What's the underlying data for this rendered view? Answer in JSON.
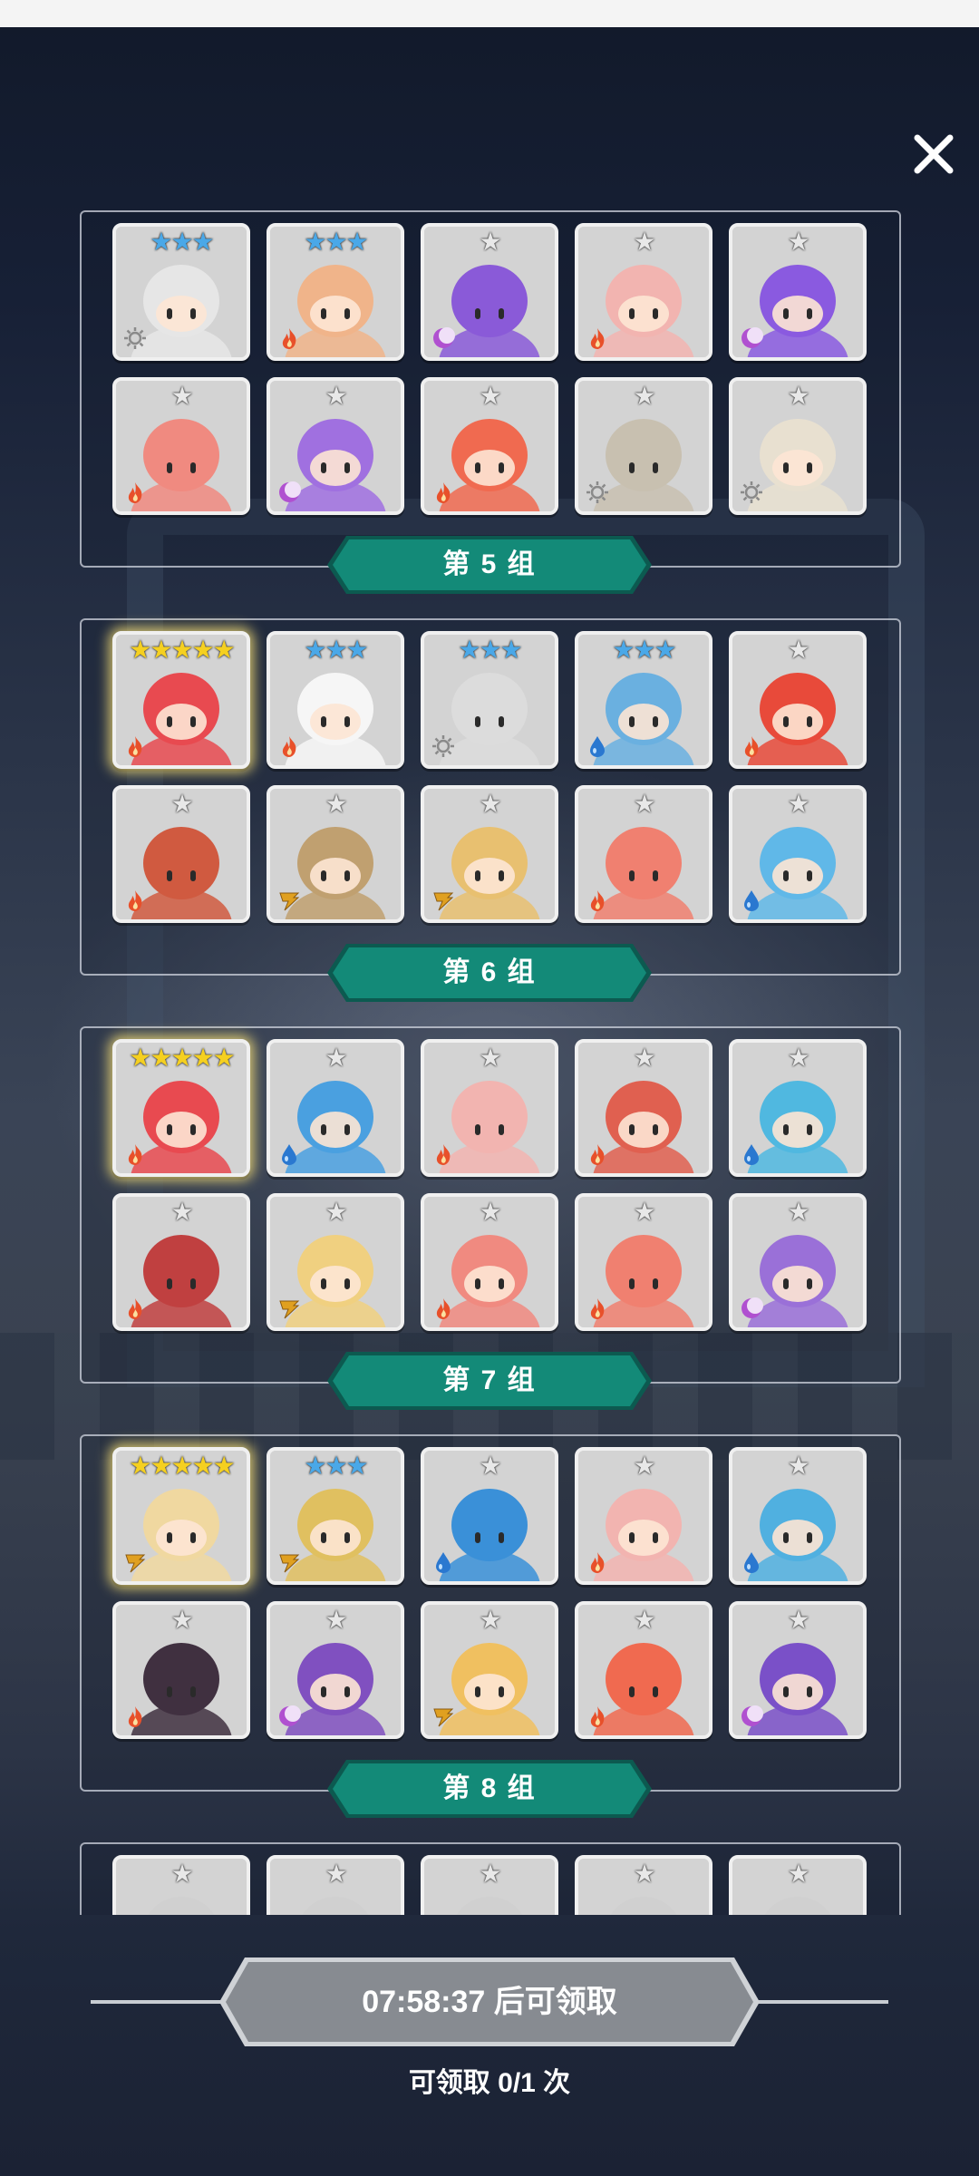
{
  "close_icon": "close-icon",
  "groups": [
    {
      "label": "第 5 组",
      "heroes": [
        {
          "stars": 3,
          "element": "light",
          "color": "#e6e6e6"
        },
        {
          "stars": 3,
          "element": "fire",
          "color": "#f0b48a"
        },
        {
          "stars": 1,
          "element": "dark",
          "color": "#8a5ad8"
        },
        {
          "stars": 1,
          "element": "fire",
          "color": "#f2b4b0"
        },
        {
          "stars": 1,
          "element": "dark",
          "color": "#8a5ae0"
        },
        {
          "stars": 1,
          "element": "fire",
          "color": "#f08a80"
        },
        {
          "stars": 1,
          "element": "dark",
          "color": "#a070e0"
        },
        {
          "stars": 1,
          "element": "fire",
          "color": "#f06a50"
        },
        {
          "stars": 1,
          "element": "light",
          "color": "#c8c0b0"
        },
        {
          "stars": 1,
          "element": "light",
          "color": "#e8e0d0"
        }
      ]
    },
    {
      "label": "第 6 组",
      "heroes": [
        {
          "stars": 5,
          "element": "fire",
          "color": "#e84a50",
          "gold": true
        },
        {
          "stars": 3,
          "element": "fire",
          "color": "#f6f6f6"
        },
        {
          "stars": 3,
          "element": "light",
          "color": "#dcdcdc"
        },
        {
          "stars": 3,
          "element": "water",
          "color": "#6ab0e0"
        },
        {
          "stars": 1,
          "element": "fire",
          "color": "#e84a3a"
        },
        {
          "stars": 1,
          "element": "fire",
          "color": "#d05a40"
        },
        {
          "stars": 1,
          "element": "thunder",
          "color": "#c0a070"
        },
        {
          "stars": 1,
          "element": "thunder",
          "color": "#e8c070"
        },
        {
          "stars": 1,
          "element": "fire",
          "color": "#f08070"
        },
        {
          "stars": 1,
          "element": "water",
          "color": "#60b8e8"
        }
      ]
    },
    {
      "label": "第 7 组",
      "heroes": [
        {
          "stars": 5,
          "element": "fire",
          "color": "#e84a50",
          "gold": true
        },
        {
          "stars": 1,
          "element": "water",
          "color": "#4aa0e0"
        },
        {
          "stars": 1,
          "element": "fire",
          "color": "#f2b4b0"
        },
        {
          "stars": 1,
          "element": "fire",
          "color": "#e06050"
        },
        {
          "stars": 1,
          "element": "water",
          "color": "#50b8e0"
        },
        {
          "stars": 1,
          "element": "fire",
          "color": "#c04040"
        },
        {
          "stars": 1,
          "element": "thunder",
          "color": "#f0d080"
        },
        {
          "stars": 1,
          "element": "fire",
          "color": "#f08a80"
        },
        {
          "stars": 1,
          "element": "fire",
          "color": "#f08070"
        },
        {
          "stars": 1,
          "element": "dark",
          "color": "#9a70d8"
        }
      ]
    },
    {
      "label": "第 8 组",
      "heroes": [
        {
          "stars": 5,
          "element": "thunder",
          "color": "#f0d8a0",
          "gold": true
        },
        {
          "stars": 3,
          "element": "thunder",
          "color": "#e0c060"
        },
        {
          "stars": 1,
          "element": "water",
          "color": "#3a90d8"
        },
        {
          "stars": 1,
          "element": "fire",
          "color": "#f2b4b0"
        },
        {
          "stars": 1,
          "element": "water",
          "color": "#50b0e0"
        },
        {
          "stars": 1,
          "element": "fire",
          "color": "#403040"
        },
        {
          "stars": 1,
          "element": "dark",
          "color": "#8050c0"
        },
        {
          "stars": 1,
          "element": "thunder",
          "color": "#f0c060"
        },
        {
          "stars": 1,
          "element": "fire",
          "color": "#f06a50"
        },
        {
          "stars": 1,
          "element": "dark",
          "color": "#7a50c8"
        }
      ]
    },
    {
      "label": "",
      "heroes": [
        {
          "stars": 1,
          "element": "light",
          "color": "#d0d0d0"
        },
        {
          "stars": 1,
          "element": "light",
          "color": "#d0d0d0"
        },
        {
          "stars": 1,
          "element": "light",
          "color": "#d0d0d0"
        },
        {
          "stars": 1,
          "element": "light",
          "color": "#d0d0d0"
        },
        {
          "stars": 1,
          "element": "light",
          "color": "#d0d0d0"
        }
      ]
    }
  ],
  "claim": {
    "timer": "07:58:37",
    "button_label": "07:58:37 后可领取",
    "count_text": "可领取 0/1 次"
  },
  "colors": {
    "label_teal": "#138a78",
    "claim_gray": "#8a8e94",
    "element_fire": "#e8502a",
    "element_water": "#2a78d0",
    "element_dark": "#b050d0",
    "element_light": "#9a9a9a",
    "element_thunder": "#e0a020"
  }
}
